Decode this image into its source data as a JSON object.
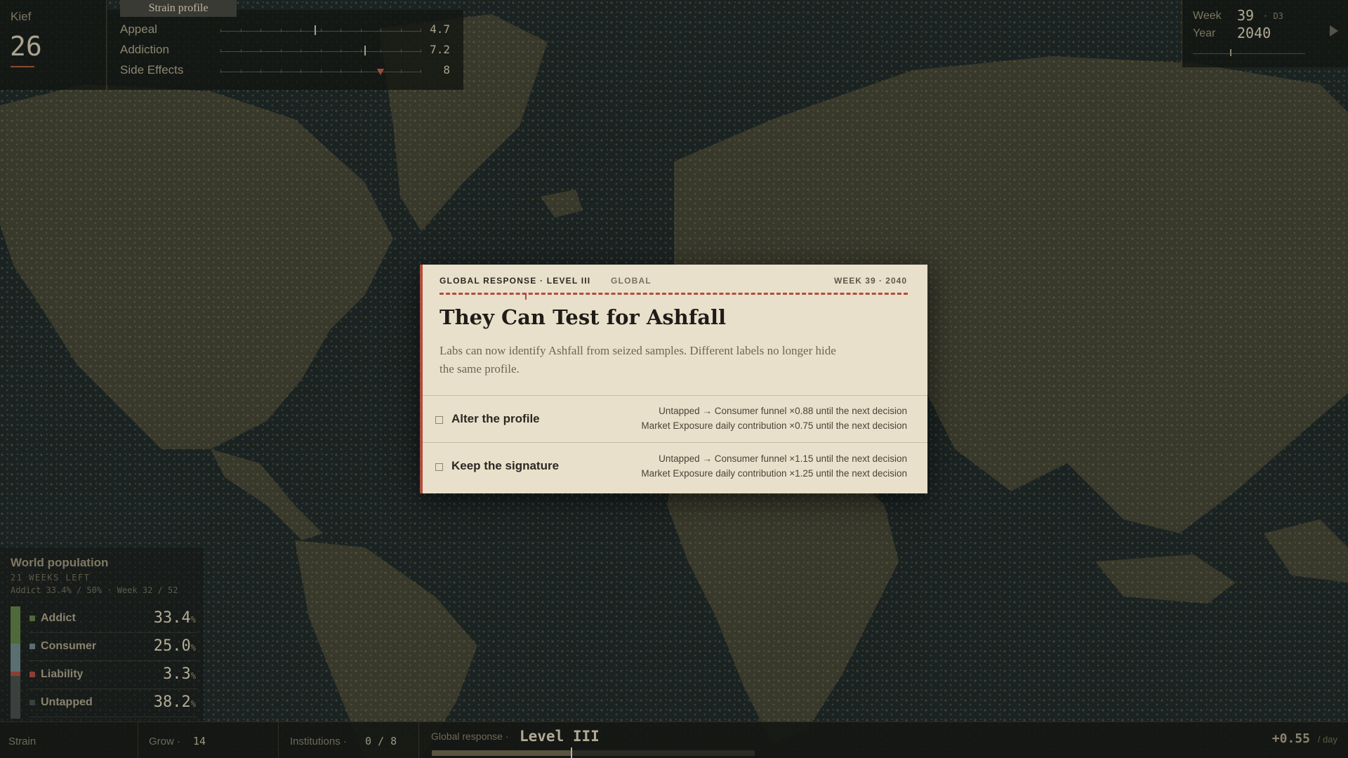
{
  "kief": {
    "label": "Kief",
    "value": "26"
  },
  "strain_profile": {
    "tab_label": "Strain profile",
    "stats": [
      {
        "name": "Appeal",
        "value": "4.7",
        "level": 0.47,
        "marker": "line"
      },
      {
        "name": "Addiction",
        "value": "7.2",
        "level": 0.72,
        "marker": "line"
      },
      {
        "name": "Side Effects",
        "value": "8",
        "level": 0.8,
        "marker": "triangle"
      }
    ]
  },
  "clock": {
    "week_label": "Week",
    "week_value": "39",
    "day": "· D3",
    "year_label": "Year",
    "year_value": "2040",
    "progress": 0.32
  },
  "modal": {
    "kicker": "GLOBAL RESPONSE · LEVEL III",
    "scope": "GLOBAL",
    "week_info": "WEEK 39 · 2040",
    "title": "They Can Test for Ashfall",
    "description": "Labs can now identify Ashfall from seized samples. Different labels no longer hide the same profile.",
    "choices": [
      {
        "label": "Alter the profile",
        "effects": [
          "Untapped → Consumer funnel ×0.88 until the next decision",
          "Market Exposure daily contribution ×0.75 until the next decision"
        ]
      },
      {
        "label": "Keep the signature",
        "effects": [
          "Untapped → Consumer funnel ×1.15 until the next decision",
          "Market Exposure daily contribution ×1.25 until the next decision"
        ]
      }
    ]
  },
  "population": {
    "title": "World population",
    "weeks_left": "21 WEEKS LEFT",
    "summary": "Addict 33.4% / 50% · Week 32 / 52",
    "percent_sign": "%",
    "rows": [
      {
        "name": "Addict",
        "value": "33.4",
        "fraction": 0.334,
        "color": "#4f6a3a"
      },
      {
        "name": "Consumer",
        "value": "25.0",
        "fraction": 0.25,
        "color": "#5a6f70"
      },
      {
        "name": "Liability",
        "value": "3.3",
        "fraction": 0.033,
        "color": "#8a3f35"
      },
      {
        "name": "Untapped",
        "value": "38.2",
        "fraction": 0.382,
        "color": "#3c403d"
      }
    ]
  },
  "bottom": {
    "strain_label": "Strain",
    "grow_label": "Grow ·",
    "grow_value": "14",
    "institutions_label": "Institutions ·",
    "institutions_value": "0 / 8",
    "response_label": "Global response ·",
    "response_level": "Level III",
    "response_progress": 0.43,
    "rate_value": "+0.55",
    "rate_unit": "/ day"
  },
  "colors": {
    "accent_red": "#b14d3d",
    "modal_bg": "#e9e0cb",
    "map_ocean": "#1b2322",
    "map_land": "#3a3a2c"
  }
}
